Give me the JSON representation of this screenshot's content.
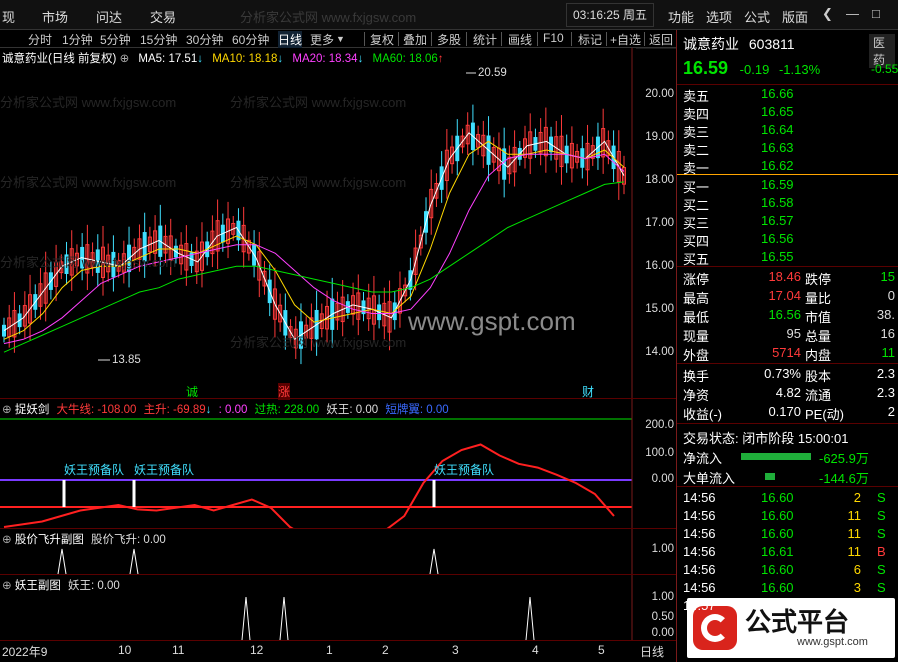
{
  "menubar": {
    "items": [
      "现",
      "市场",
      "问达",
      "交易"
    ],
    "watermark_text": "分析家公式网 www.fxjgsw.com",
    "time": "03:16:25 周五",
    "right_items": [
      "功能",
      "选项",
      "公式",
      "版面"
    ],
    "back_icon": "chevron-left-icon",
    "minimize_icon": "minimize-icon",
    "restore_icon": "restore-icon"
  },
  "toolbar": {
    "periods": [
      "分时",
      "1分钟",
      "5分钟",
      "15分钟",
      "30分钟",
      "60分钟",
      "日线",
      "更多"
    ],
    "active_period": "日线",
    "tools": [
      "复权",
      "叠加",
      "多股",
      "统计",
      "画线",
      "F10",
      "标记",
      "+自选",
      "返回"
    ]
  },
  "main_chart": {
    "stock_title": "诚意药业(日线 前复权)",
    "ma_labels": [
      {
        "text": "MA5: 17.51",
        "color": "#ffffff"
      },
      {
        "text": "MA10: 18.18",
        "color": "#ffd800"
      },
      {
        "text": "MA20: 18.34",
        "color": "#ff40ff"
      },
      {
        "text": "MA60: 18.06",
        "color": "#00e400"
      }
    ],
    "price_axis": [
      "20.00",
      "19.00",
      "18.00",
      "17.00",
      "16.00",
      "15.00",
      "14.00"
    ],
    "high_label": "20.59",
    "low_label": "13.85",
    "center_watermark": "www.gspt.com",
    "markers": [
      {
        "text": "诚",
        "color": "#00e400"
      },
      {
        "text": "涨",
        "color": "#ff3a3a"
      },
      {
        "text": "财",
        "color": "#40e0ff"
      }
    ]
  },
  "indicator1": {
    "name": "捉妖剑",
    "labels": [
      {
        "text": "大牛线: -108.00",
        "color": "#ff3a3a"
      },
      {
        "text": "主升: -69.89",
        "color": "#ff3a3a"
      },
      {
        "text": ": 0.00",
        "color": "#ff40ff"
      },
      {
        "text": "过热: 228.00",
        "color": "#00e400"
      },
      {
        "text": "妖王: 0.00",
        "color": "#dddddd"
      },
      {
        "text": "短牌翼: 0.00",
        "color": "#3a6aff"
      }
    ],
    "axis": [
      "200.0",
      "100.0",
      "0.00"
    ],
    "annotations": [
      "妖王预备队",
      "妖王预备队",
      "妖王预备队"
    ]
  },
  "indicator2": {
    "name": "股价飞升副图",
    "label": "股价飞升: 0.00",
    "axis": [
      "1.00"
    ]
  },
  "indicator3": {
    "name": "妖王副图",
    "label": "妖王: 0.00",
    "axis": [
      "1.00",
      "0.50",
      "0.00"
    ]
  },
  "date_axis": [
    "2022年9",
    "10",
    "11",
    "12",
    "1",
    "2",
    "3",
    "4",
    "5"
  ],
  "date_axis_right": "日线",
  "quote_panel": {
    "name": "诚意药业",
    "code": "603811",
    "sector_tag": "医药",
    "price": "16.59",
    "change": "-0.19",
    "change_pct": "-1.13%",
    "side_pct": "-0.55",
    "asks": [
      {
        "label": "卖五",
        "price": "16.66"
      },
      {
        "label": "卖四",
        "price": "16.65"
      },
      {
        "label": "卖三",
        "price": "16.64"
      },
      {
        "label": "卖二",
        "price": "16.63"
      },
      {
        "label": "卖一",
        "price": "16.62"
      }
    ],
    "bids": [
      {
        "label": "买一",
        "price": "16.59"
      },
      {
        "label": "买二",
        "price": "16.58"
      },
      {
        "label": "买三",
        "price": "16.57"
      },
      {
        "label": "买四",
        "price": "16.56"
      },
      {
        "label": "买五",
        "price": "16.55"
      }
    ],
    "stats": [
      {
        "k1": "涨停",
        "v1": "18.46",
        "c1": "#ff3a3a",
        "k2": "跌停",
        "v2": "15",
        "c2": "#00e400"
      },
      {
        "k1": "最高",
        "v1": "17.04",
        "c1": "#ff3a3a",
        "k2": "量比",
        "v2": "0",
        "c2": "#ddd"
      },
      {
        "k1": "最低",
        "v1": "16.56",
        "c1": "#00e400",
        "k2": "市值",
        "v2": "38.",
        "c2": "#ddd"
      },
      {
        "k1": "现量",
        "v1": "95",
        "c1": "#ddd",
        "k2": "总量",
        "v2": "16",
        "c2": "#ddd"
      },
      {
        "k1": "外盘",
        "v1": "5714",
        "c1": "#ff3a3a",
        "k2": "内盘",
        "v2": "11",
        "c2": "#00e400"
      }
    ],
    "stats2": [
      {
        "k1": "换手",
        "v1": "0.73%",
        "k2": "股本",
        "v2": "2.3"
      },
      {
        "k1": "净资",
        "v1": "4.82",
        "k2": "流通",
        "v2": "2.3"
      },
      {
        "k1": "收益(-)",
        "v1": "0.170",
        "k2": "PE(动)",
        "v2": "2"
      }
    ],
    "trade_status": "交易状态: 闭市阶段 15:00:01",
    "net_inflow_label": "净流入",
    "net_inflow_value": "-625.9万",
    "big_inflow_label": "大单流入",
    "big_inflow_value": "-144.6万",
    "ticks": [
      {
        "time": "14:56",
        "price": "16.60",
        "vol": "2",
        "side": "S"
      },
      {
        "time": "14:56",
        "price": "16.60",
        "vol": "11",
        "side": "S"
      },
      {
        "time": "14:56",
        "price": "16.60",
        "vol": "11",
        "side": "S"
      },
      {
        "time": "14:56",
        "price": "16.61",
        "vol": "11",
        "side": "B"
      },
      {
        "time": "14:56",
        "price": "16.60",
        "vol": "6",
        "side": "S"
      },
      {
        "time": "14:56",
        "price": "16.60",
        "vol": "3",
        "side": "S"
      },
      {
        "time": "14:57",
        "price": "",
        "vol": "",
        "side": ""
      }
    ],
    "logo_text": "公式平台",
    "logo_url": "www.gspt.com"
  },
  "chart_data": {
    "type": "line",
    "title": "诚意药业(日线 前复权)",
    "xlabel": "",
    "ylabel": "",
    "ylim": [
      13.5,
      20.8
    ],
    "x_ticks": [
      "2022年9",
      "10",
      "11",
      "12",
      "1",
      "2",
      "3",
      "4",
      "5"
    ],
    "series": [
      {
        "name": "MA5",
        "color": "#ffffff",
        "values": [
          14.6,
          14.9,
          15.5,
          16.1,
          16.3,
          16.2,
          16.1,
          16.5,
          16.7,
          16.4,
          16.2,
          16.8,
          17.0,
          16.3,
          15.2,
          14.4,
          14.7,
          15.0,
          15.2,
          15.1,
          14.9,
          15.8,
          17.5,
          18.6,
          19.2,
          18.8,
          18.4,
          18.9,
          19.0,
          18.7,
          18.6,
          19.0,
          18.2
        ]
      },
      {
        "name": "MA10",
        "color": "#ffd800",
        "values": [
          14.4,
          14.6,
          15.0,
          15.6,
          16.0,
          16.1,
          16.1,
          16.3,
          16.5,
          16.5,
          16.4,
          16.6,
          16.8,
          16.6,
          16.0,
          15.2,
          14.8,
          14.9,
          15.0,
          15.1,
          15.0,
          15.4,
          16.5,
          17.8,
          18.7,
          19.0,
          18.7,
          18.7,
          18.8,
          18.7,
          18.6,
          18.8,
          18.4
        ]
      },
      {
        "name": "MA20",
        "color": "#ff40ff",
        "values": [
          14.3,
          14.4,
          14.6,
          14.9,
          15.3,
          15.7,
          15.9,
          16.1,
          16.2,
          16.3,
          16.4,
          16.5,
          16.6,
          16.6,
          16.4,
          16.0,
          15.6,
          15.3,
          15.1,
          15.0,
          15.0,
          15.1,
          15.6,
          16.4,
          17.4,
          18.2,
          18.6,
          18.7,
          18.7,
          18.7,
          18.6,
          18.7,
          18.3
        ]
      },
      {
        "name": "MA60",
        "color": "#00e400",
        "values": [
          14.1,
          14.3,
          14.5,
          14.7,
          14.9,
          15.1,
          15.3,
          15.5,
          15.6,
          15.8,
          15.9,
          16.0,
          16.1,
          16.1,
          16.0,
          15.9,
          15.8,
          15.7,
          15.6,
          15.5,
          15.5,
          15.6,
          15.8,
          16.1,
          16.4,
          16.7,
          17.0,
          17.2,
          17.4,
          17.6,
          17.8,
          18.0,
          18.06
        ]
      }
    ],
    "indicator_main_line": [
      -60,
      -55,
      -50,
      -40,
      -30,
      -25,
      -20,
      -28,
      -30,
      -25,
      -20,
      -30,
      -20,
      -10,
      -25,
      -60,
      -80,
      -75,
      -72,
      -70,
      -66,
      -40,
      20,
      60,
      80,
      90,
      70,
      55,
      48,
      35,
      20,
      0,
      -40
    ]
  }
}
